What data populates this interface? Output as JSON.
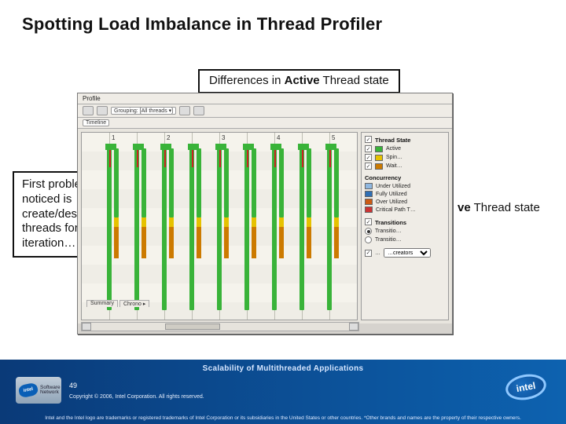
{
  "title": "Spotting Load Imbalance in Thread Profiler",
  "callouts": {
    "top": "Differences in <b>Active</b> Thread state",
    "left": "First problem noticed is create/destroy threads for each iteration…",
    "mid": "…but there is a difference in <b>Active</b> Thread state within pairs.",
    "side": "<b>ve</b> Thread state"
  },
  "profiler": {
    "menu": {
      "item": "Profile"
    },
    "toolbar": {
      "grouping": "Grouping: [All threads ▾]"
    },
    "tab": "Timeline",
    "axis_labels": [
      "1",
      "2",
      "3",
      "4",
      "5"
    ],
    "bottom_tabs": [
      "Summary",
      "Chrono ▸"
    ]
  },
  "legend": {
    "header1": "Thread State",
    "states": [
      {
        "label": "Active",
        "checked": true,
        "swatch": "active"
      },
      {
        "label": "Spin…",
        "checked": true,
        "swatch": "spin"
      },
      {
        "label": "Wait…",
        "checked": true,
        "swatch": "wait"
      }
    ],
    "header2": "Concurrency",
    "conc": [
      {
        "label": "Under Utilized",
        "swatch": "under"
      },
      {
        "label": "Fully Utilized",
        "swatch": "fully"
      },
      {
        "label": "Over Utilized",
        "swatch": "over"
      },
      {
        "label": "Critical Path T…",
        "swatch": "critical"
      }
    ],
    "header3": "Transitions",
    "trans_radio": [
      {
        "label": "Transitio…",
        "selected": true
      },
      {
        "label": "Transitio…",
        "selected": false
      }
    ],
    "creators": {
      "cb_label": "…",
      "select_label": "…creators"
    }
  },
  "footer": {
    "scalability": "Scalability of Multithreaded Applications",
    "page": "49",
    "copyright": "Copyright © 2006, Intel Corporation. All rights reserved.",
    "legal": "Intel and the Intel logo are trademarks or registered trademarks of Intel Corporation or its subsidiaries in the United States or other countries. *Other brands and names are the property of their respective owners.",
    "sw_badge_text": "Software\nNetwork",
    "intel_word": "intel"
  }
}
